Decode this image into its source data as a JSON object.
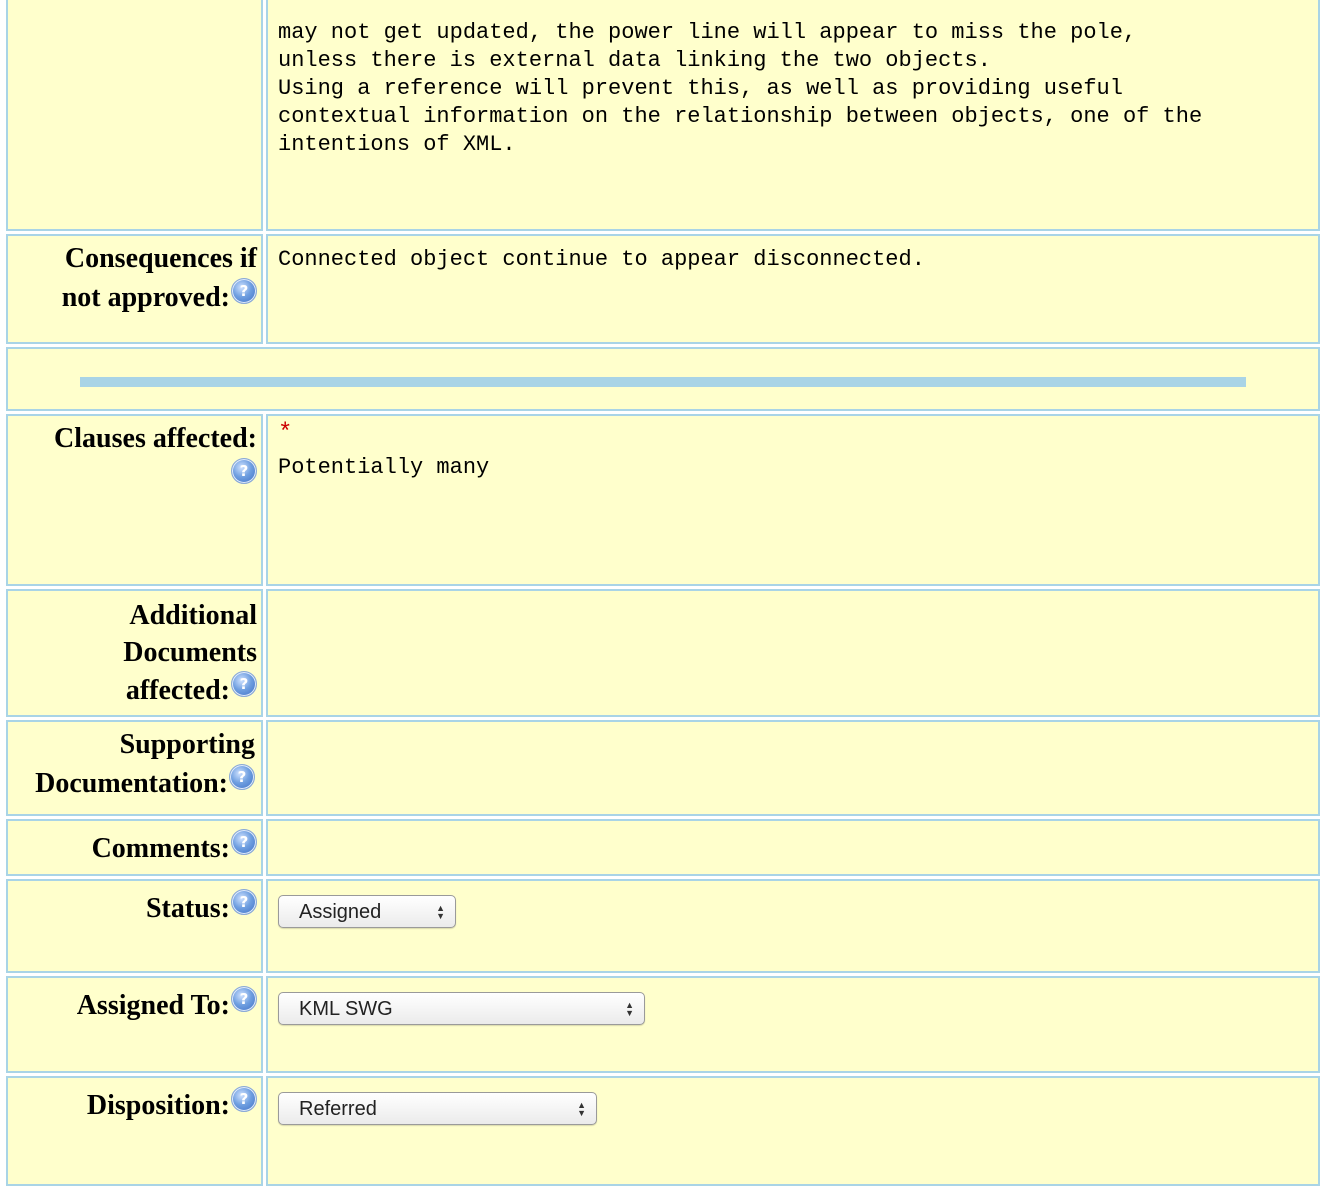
{
  "rows": {
    "justification": {
      "lines": [
        "may not get updated, the power line will appear to miss the pole,",
        "unless there is external data linking the two objects.",
        "Using a reference will prevent this, as well as providing useful",
        "contextual information on the relationship between objects, one of the",
        "intentions of XML."
      ]
    },
    "consequences": {
      "label_line1": "Consequences if",
      "label_line2": "not approved:",
      "value": "Connected object continue to appear disconnected."
    },
    "clauses": {
      "label": "Clauses affected:",
      "required_marker": "*",
      "value": "Potentially many"
    },
    "additional_docs": {
      "label_line1": "Additional",
      "label_line2": "Documents",
      "label_line3": "affected:",
      "value": ""
    },
    "supporting_docs": {
      "label_line1": "Supporting",
      "label_line2": "Documentation:",
      "value": ""
    },
    "comments": {
      "label": "Comments:",
      "value": ""
    },
    "status": {
      "label": "Status:",
      "selected": "Assigned"
    },
    "assigned_to": {
      "label": "Assigned To:",
      "selected": "KML SWG"
    },
    "disposition": {
      "label": "Disposition:",
      "selected": "Referred"
    }
  },
  "help_icon": {
    "name": "help-icon",
    "glyph": "?"
  },
  "colors": {
    "cell_background": "#ffffcc",
    "cell_border": "#a9d4e6",
    "required": "#cc0000"
  }
}
